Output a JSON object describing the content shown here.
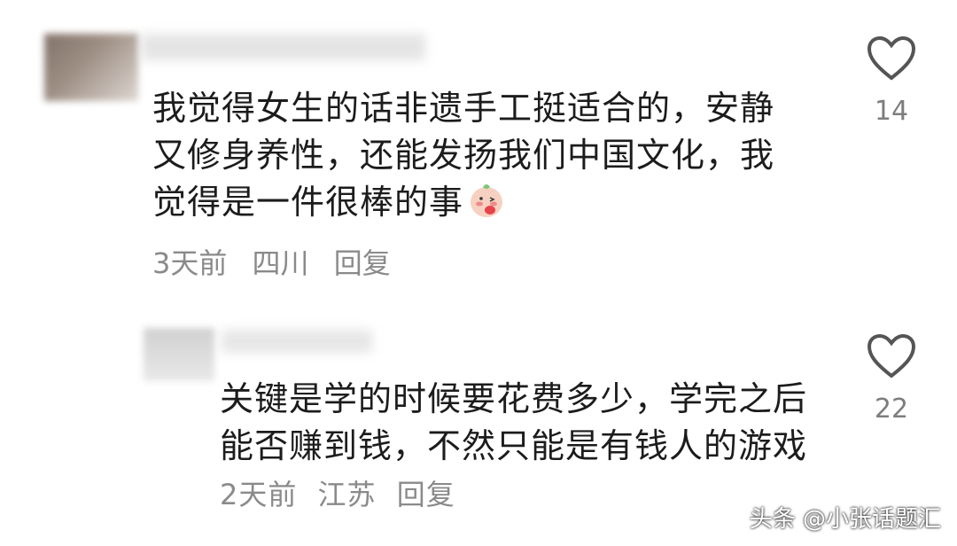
{
  "comments": [
    {
      "text": "我觉得女生的话非遗手工挺适合的，安静又修身养性，还能发扬我们中国文化，我觉得是一件很棒的事",
      "time": "3天前",
      "location": "四川",
      "reply_label": "回复",
      "likes": "14",
      "emoji": "blushing-peach-emoji"
    },
    {
      "text": "关键是学的时候要花费多少，学完之后能否赚到钱，不然只能是有钱人的游戏",
      "time": "2天前",
      "location": "江苏",
      "reply_label": "回复",
      "likes": "22"
    }
  ],
  "watermark": "头条 @小张话题汇",
  "icons": {
    "like": "heart-outline-icon"
  },
  "colors": {
    "meta": "#8a8a8a",
    "text": "#1c1c1c",
    "heart": "#555555"
  }
}
